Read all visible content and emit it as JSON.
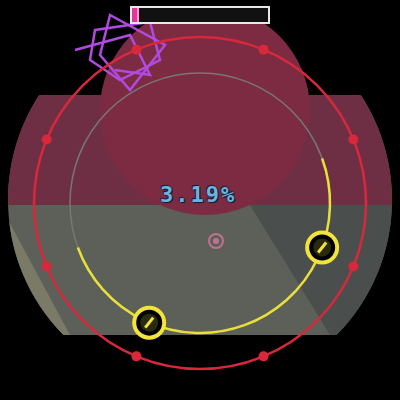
{
  "hud": {
    "progress": {
      "level": 0.05
    },
    "accuracy": "3.19%"
  },
  "notes": [
    {
      "kind": "tap"
    },
    {
      "kind": "tap"
    }
  ]
}
